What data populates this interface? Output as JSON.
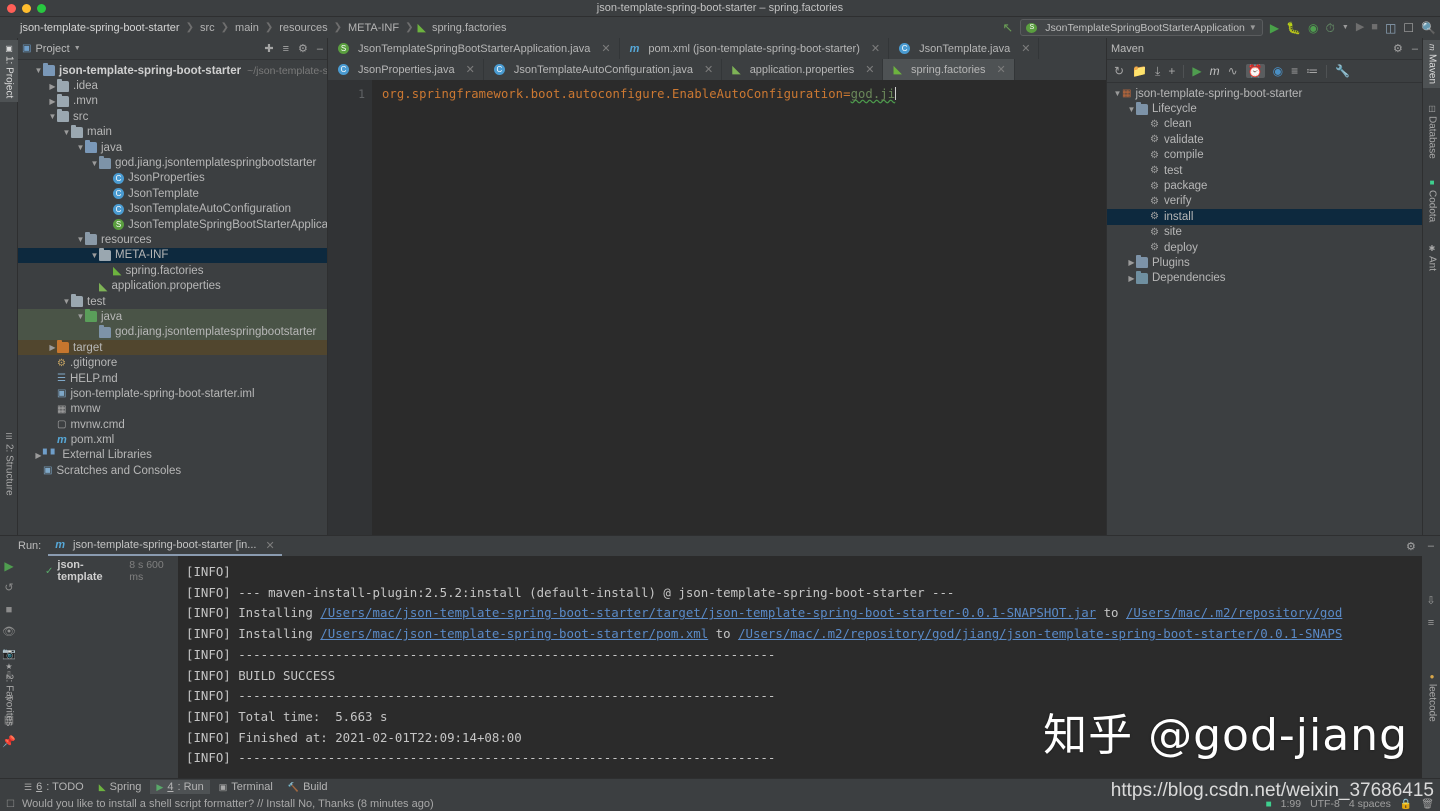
{
  "window": {
    "title": "json-template-spring-boot-starter – spring.factories"
  },
  "breadcrumb": {
    "items": [
      "json-template-spring-boot-starter",
      "src",
      "main",
      "resources",
      "META-INF",
      "spring.factories"
    ]
  },
  "navbar": {
    "run_config": "JsonTemplateSpringBootStarterApplication",
    "icons": [
      "back-arrow-icon",
      "run-icon",
      "debug-icon",
      "coverage-icon",
      "profile-icon",
      "dropdown-icon",
      "run-disabled-icon",
      "stop-icon",
      "project-structure-icon",
      "layout-icon",
      "search-icon"
    ]
  },
  "left_toolstrip": {
    "tabs": [
      "1: Project",
      "2: Structure",
      "2: Favorites"
    ]
  },
  "right_toolstrip": {
    "tabs": [
      "Maven",
      "Database",
      "Codota",
      "Ant",
      "leetcode"
    ]
  },
  "project_panel": {
    "title": "Project",
    "tools": [
      "collapse-target-icon",
      "expand-all-icon",
      "settings-icon",
      "hide-icon"
    ],
    "tree": [
      {
        "depth": 0,
        "arrow": "down",
        "icon": "module-icon",
        "label": "json-template-spring-boot-starter",
        "sub": "~/json-template-s|",
        "bold": true
      },
      {
        "depth": 1,
        "arrow": "right",
        "icon": "folder-grey",
        "label": ".idea"
      },
      {
        "depth": 1,
        "arrow": "right",
        "icon": "folder-grey",
        "label": ".mvn"
      },
      {
        "depth": 1,
        "arrow": "down",
        "icon": "folder-grey",
        "label": "src"
      },
      {
        "depth": 2,
        "arrow": "down",
        "icon": "folder-grey",
        "label": "main"
      },
      {
        "depth": 3,
        "arrow": "down",
        "icon": "folder-blue",
        "label": "java"
      },
      {
        "depth": 4,
        "arrow": "down",
        "icon": "package-icon",
        "label": "god.jiang.jsontemplatespringbootstarter"
      },
      {
        "depth": 5,
        "arrow": "none",
        "icon": "class-icon",
        "label": "JsonProperties"
      },
      {
        "depth": 5,
        "arrow": "none",
        "icon": "class-icon",
        "label": "JsonTemplate"
      },
      {
        "depth": 5,
        "arrow": "none",
        "icon": "class-icon",
        "label": "JsonTemplateAutoConfiguration"
      },
      {
        "depth": 5,
        "arrow": "none",
        "icon": "spring-class-icon",
        "label": "JsonTemplateSpringBootStarterApplication"
      },
      {
        "depth": 3,
        "arrow": "down",
        "icon": "resources-icon",
        "label": "resources"
      },
      {
        "depth": 4,
        "arrow": "down",
        "icon": "folder-grey",
        "label": "META-INF",
        "state": "selected"
      },
      {
        "depth": 5,
        "arrow": "none",
        "icon": "spring-file-icon",
        "label": "spring.factories"
      },
      {
        "depth": 4,
        "arrow": "none",
        "icon": "properties-icon",
        "label": "application.properties"
      },
      {
        "depth": 2,
        "arrow": "down",
        "icon": "folder-grey",
        "label": "test"
      },
      {
        "depth": 3,
        "arrow": "down",
        "icon": "folder-green",
        "label": "java",
        "state": "test-source"
      },
      {
        "depth": 4,
        "arrow": "none",
        "icon": "package-icon",
        "label": "god.jiang.jsontemplatespringbootstarter",
        "state": "test-source"
      },
      {
        "depth": 1,
        "arrow": "right",
        "icon": "folder-orange",
        "label": "target",
        "state": "excluded"
      },
      {
        "depth": 1,
        "arrow": "none",
        "icon": "gitignore-icon",
        "label": ".gitignore"
      },
      {
        "depth": 1,
        "arrow": "none",
        "icon": "markdown-icon",
        "label": "HELP.md"
      },
      {
        "depth": 1,
        "arrow": "none",
        "icon": "iml-icon",
        "label": "json-template-spring-boot-starter.iml"
      },
      {
        "depth": 1,
        "arrow": "none",
        "icon": "script-icon",
        "label": "mvnw"
      },
      {
        "depth": 1,
        "arrow": "none",
        "icon": "cmd-icon",
        "label": "mvnw.cmd"
      },
      {
        "depth": 1,
        "arrow": "none",
        "icon": "maven-icon",
        "label": "pom.xml"
      },
      {
        "depth": 0,
        "arrow": "right",
        "icon": "libraries-icon",
        "label": "External Libraries"
      },
      {
        "depth": 0,
        "arrow": "none",
        "icon": "scratches-icon",
        "label": "Scratches and Consoles"
      }
    ]
  },
  "editor": {
    "tabs_row1": [
      {
        "label": "JsonTemplateSpringBootStarterApplication.java",
        "icon": "spring-class-icon",
        "active": false
      },
      {
        "label": "pom.xml (json-template-spring-boot-starter)",
        "icon": "maven-icon",
        "active": false
      },
      {
        "label": "JsonTemplate.java",
        "icon": "class-icon",
        "active": false
      }
    ],
    "tabs_row2": [
      {
        "label": "JsonProperties.java",
        "icon": "class-icon",
        "active": false
      },
      {
        "label": "JsonTemplateAutoConfiguration.java",
        "icon": "class-icon",
        "active": false
      },
      {
        "label": "application.properties",
        "icon": "properties-icon",
        "active": false
      },
      {
        "label": "spring.factories",
        "icon": "spring-file-icon",
        "active": true
      }
    ],
    "lines": [
      {
        "number": "1",
        "key": "org.springframework.boot.autoconfigure.EnableAutoConfiguration",
        "eq": "=",
        "value": "god.ji"
      }
    ]
  },
  "maven_panel": {
    "title": "Maven",
    "toolbar_icons": [
      "refresh-icon",
      "add-maven-project-icon",
      "download-sources-icon",
      "plus-icon",
      "run-icon",
      "maven-icon",
      "toggle-skip-tests-icon",
      "execute-goal-icon",
      "offline-mode-icon",
      "expand-icon",
      "collapse-icon",
      "settings-wrench-icon"
    ],
    "header_icons": [
      "gear-icon",
      "hide-icon"
    ],
    "tree": [
      {
        "depth": 0,
        "arrow": "down",
        "icon": "maven-project-icon",
        "label": "json-template-spring-boot-starter"
      },
      {
        "depth": 1,
        "arrow": "down",
        "icon": "lifecycle-icon",
        "label": "Lifecycle"
      },
      {
        "depth": 2,
        "arrow": "none",
        "icon": "goal-icon",
        "label": "clean"
      },
      {
        "depth": 2,
        "arrow": "none",
        "icon": "goal-icon",
        "label": "validate"
      },
      {
        "depth": 2,
        "arrow": "none",
        "icon": "goal-icon",
        "label": "compile"
      },
      {
        "depth": 2,
        "arrow": "none",
        "icon": "goal-icon",
        "label": "test"
      },
      {
        "depth": 2,
        "arrow": "none",
        "icon": "goal-icon",
        "label": "package"
      },
      {
        "depth": 2,
        "arrow": "none",
        "icon": "goal-icon",
        "label": "verify"
      },
      {
        "depth": 2,
        "arrow": "none",
        "icon": "goal-icon",
        "label": "install",
        "state": "selected"
      },
      {
        "depth": 2,
        "arrow": "none",
        "icon": "goal-icon",
        "label": "site"
      },
      {
        "depth": 2,
        "arrow": "none",
        "icon": "goal-icon",
        "label": "deploy"
      },
      {
        "depth": 1,
        "arrow": "right",
        "icon": "plugins-icon",
        "label": "Plugins"
      },
      {
        "depth": 1,
        "arrow": "right",
        "icon": "dependencies-icon",
        "label": "Dependencies"
      }
    ]
  },
  "run_panel": {
    "label": "Run:",
    "tab_label": "json-template-spring-boot-starter [in...",
    "sidebar_icons": [
      "rerun-icon",
      "rerun-failed-icon",
      "stop-icon",
      "filter-icon",
      "export-icon",
      "print-icon",
      "import-icon",
      "wrap-icon",
      "pin-icon"
    ],
    "header_icons": [
      "settings-icon",
      "hide-icon"
    ],
    "tree_item": {
      "name": "json-template",
      "duration": "8 s 600 ms",
      "status": "passed"
    },
    "console_lines": [
      {
        "prefix": "[INFO]",
        "text": ""
      },
      {
        "prefix": "[INFO]",
        "text": " --- maven-install-plugin:2.5.2:install (default-install) @ json-template-spring-boot-starter ---"
      },
      {
        "prefix": "[INFO]",
        "text": " Installing ",
        "link1": "/Users/mac/json-template-spring-boot-starter/target/json-template-spring-boot-starter-0.0.1-SNAPSHOT.jar",
        "mid": " to ",
        "link2": "/Users/mac/.m2/repository/god"
      },
      {
        "prefix": "[INFO]",
        "text": " Installing ",
        "link1": "/Users/mac/json-template-spring-boot-starter/pom.xml",
        "mid": " to ",
        "link2": "/Users/mac/.m2/repository/god/jiang/json-template-spring-boot-starter/0.0.1-SNAPS"
      },
      {
        "prefix": "[INFO]",
        "text": " ------------------------------------------------------------------------"
      },
      {
        "prefix": "[INFO]",
        "text": " BUILD SUCCESS"
      },
      {
        "prefix": "[INFO]",
        "text": " ------------------------------------------------------------------------"
      },
      {
        "prefix": "[INFO]",
        "text": " Total time:  5.663 s"
      },
      {
        "prefix": "[INFO]",
        "text": " Finished at: 2021-02-01T22:09:14+08:00"
      },
      {
        "prefix": "[INFO]",
        "text": " ------------------------------------------------------------------------"
      }
    ],
    "console_right_icons": [
      "scroll-to-end-icon",
      "soft-wrap-icon"
    ]
  },
  "bottom_bar": {
    "items": [
      {
        "num": "6",
        "label": ": TODO",
        "icon": "todo-icon",
        "active": false
      },
      {
        "num": "",
        "label": "Spring",
        "icon": "spring-leaf-icon",
        "active": false
      },
      {
        "num": "4",
        "label": ": Run",
        "icon": "run-icon",
        "active": true
      },
      {
        "num": "",
        "label": "Terminal",
        "icon": "terminal-icon",
        "active": false
      },
      {
        "num": "",
        "label": "Build",
        "icon": "build-hammer-icon",
        "active": false
      }
    ]
  },
  "status_bar": {
    "message": "Would you like to install a shell script formatter? // Install   No, Thanks (8 minutes ago)",
    "caret_position": "1:99",
    "encoding": "UTF-8",
    "indent": "4 spaces",
    "icons": [
      "event-log-icon",
      "git-branch-icon",
      "lock-icon",
      "trash-icon"
    ]
  },
  "watermarks": {
    "zhihu": "知乎 @god-jiang",
    "csdn": "https://blog.csdn.net/weixin_37686415"
  },
  "colors": {
    "accent_blue": "#0d293e",
    "spring_green": "#6db33f",
    "link_blue": "#5a8ac7",
    "panel_bg": "#3c3f41",
    "editor_bg": "#2b2b2b"
  }
}
